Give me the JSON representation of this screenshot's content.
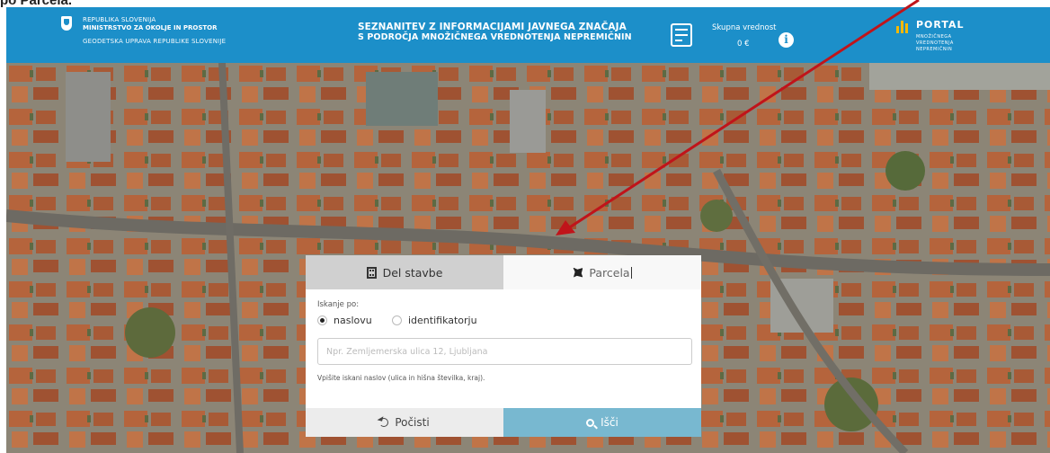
{
  "caption": "po Parcela.",
  "header": {
    "ministry_line1": "REPUBLIKA SLOVENIJA",
    "ministry_line2": "MINISTRSTVO ZA OKOLJE IN PROSTOR",
    "ministry_line3": "GEODETSKA UPRAVA REPUBLIKE SLOVENIJE",
    "title_line1": "SEZNANITEV Z INFORMACIJAMI JAVNEGA ZNAČAJA",
    "title_line2": "S PODROČJA MNOŽIČNEGA VREDNOTENJA NEPREMIČNIN",
    "summary_label": "Skupna vrednost",
    "summary_value": "0 €",
    "portal_title": "PORTAL",
    "portal_sub1": "MNOŽIČNEGA",
    "portal_sub2": "VREDNOTENJA",
    "portal_sub3": "NEPREMIČNIN"
  },
  "search_panel": {
    "tabs": [
      {
        "label": "Del stavbe",
        "icon": "building-icon",
        "active": true
      },
      {
        "label": "Parcela",
        "icon": "parcel-icon",
        "active": false
      }
    ],
    "search_by_label": "Iskanje po:",
    "radio_options": [
      {
        "label": "naslovu",
        "checked": true
      },
      {
        "label": "identifikatorju",
        "checked": false
      }
    ],
    "address_input": {
      "value": "",
      "placeholder": "Npr. Zemljemerska ulica 12, Ljubljana"
    },
    "help_text": "Vpišite iskani naslov (ulica in hišna številka, kraj).",
    "clear_button": "Počisti",
    "search_button": "Išči"
  },
  "colors": {
    "header_bg": "#1c8fc9",
    "search_button_bg": "#78b8d0",
    "annotation_arrow": "#c0141a",
    "portal_accent": "#f5b800"
  }
}
